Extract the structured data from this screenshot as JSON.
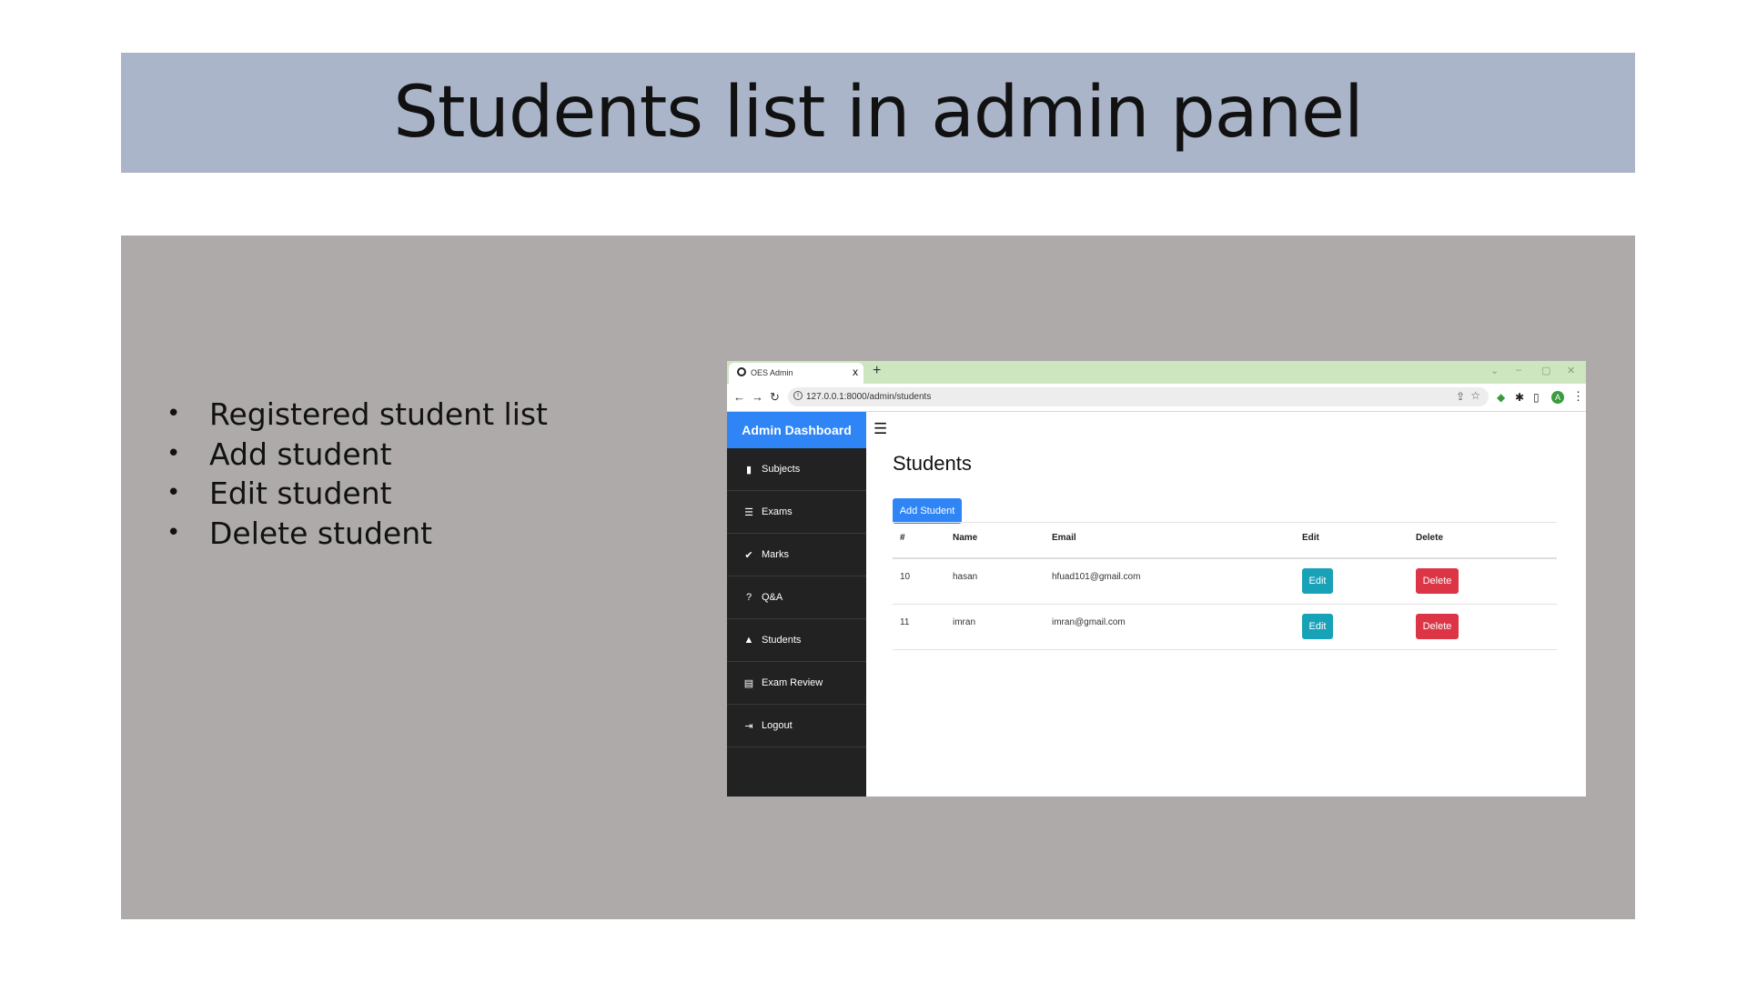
{
  "slide": {
    "title": "Students list in admin panel",
    "bullets": [
      "Registered student list",
      "Add student",
      "Edit student",
      "Delete student"
    ]
  },
  "browser": {
    "tab_title": "OES Admin",
    "tab_close": "x",
    "new_tab": "+",
    "url": "127.0.0.1:8000/admin/students",
    "avatar_letter": "A",
    "window_controls": [
      "⌄",
      "–",
      "▢",
      "✕"
    ]
  },
  "sidebar": {
    "brand": "Admin Dashboard",
    "items": [
      {
        "label": "Subjects",
        "icon": "book-icon"
      },
      {
        "label": "Exams",
        "icon": "list-icon"
      },
      {
        "label": "Marks",
        "icon": "check-icon"
      },
      {
        "label": "Q&A",
        "icon": "question-icon"
      },
      {
        "label": "Students",
        "icon": "graduation-cap-icon"
      },
      {
        "label": "Exam Review",
        "icon": "file-icon"
      },
      {
        "label": "Logout",
        "icon": "sign-out-icon"
      }
    ]
  },
  "main": {
    "page_title": "Students",
    "add_button": "Add Student",
    "table": {
      "headers": [
        "#",
        "Name",
        "Email",
        "Edit",
        "Delete"
      ],
      "rows": [
        {
          "id": "10",
          "name": "hasan",
          "email": "hfuad101@gmail.com",
          "edit": "Edit",
          "delete": "Delete"
        },
        {
          "id": "11",
          "name": "imran",
          "email": "imran@gmail.com",
          "edit": "Edit",
          "delete": "Delete"
        }
      ]
    }
  },
  "colors": {
    "title_band": "#aab5c9",
    "panel": "#adaaa9",
    "primary": "#2f85f5",
    "sidebar": "#222222",
    "edit": "#17a2b8",
    "delete": "#dc3545",
    "tabbar": "#cde6c0"
  }
}
